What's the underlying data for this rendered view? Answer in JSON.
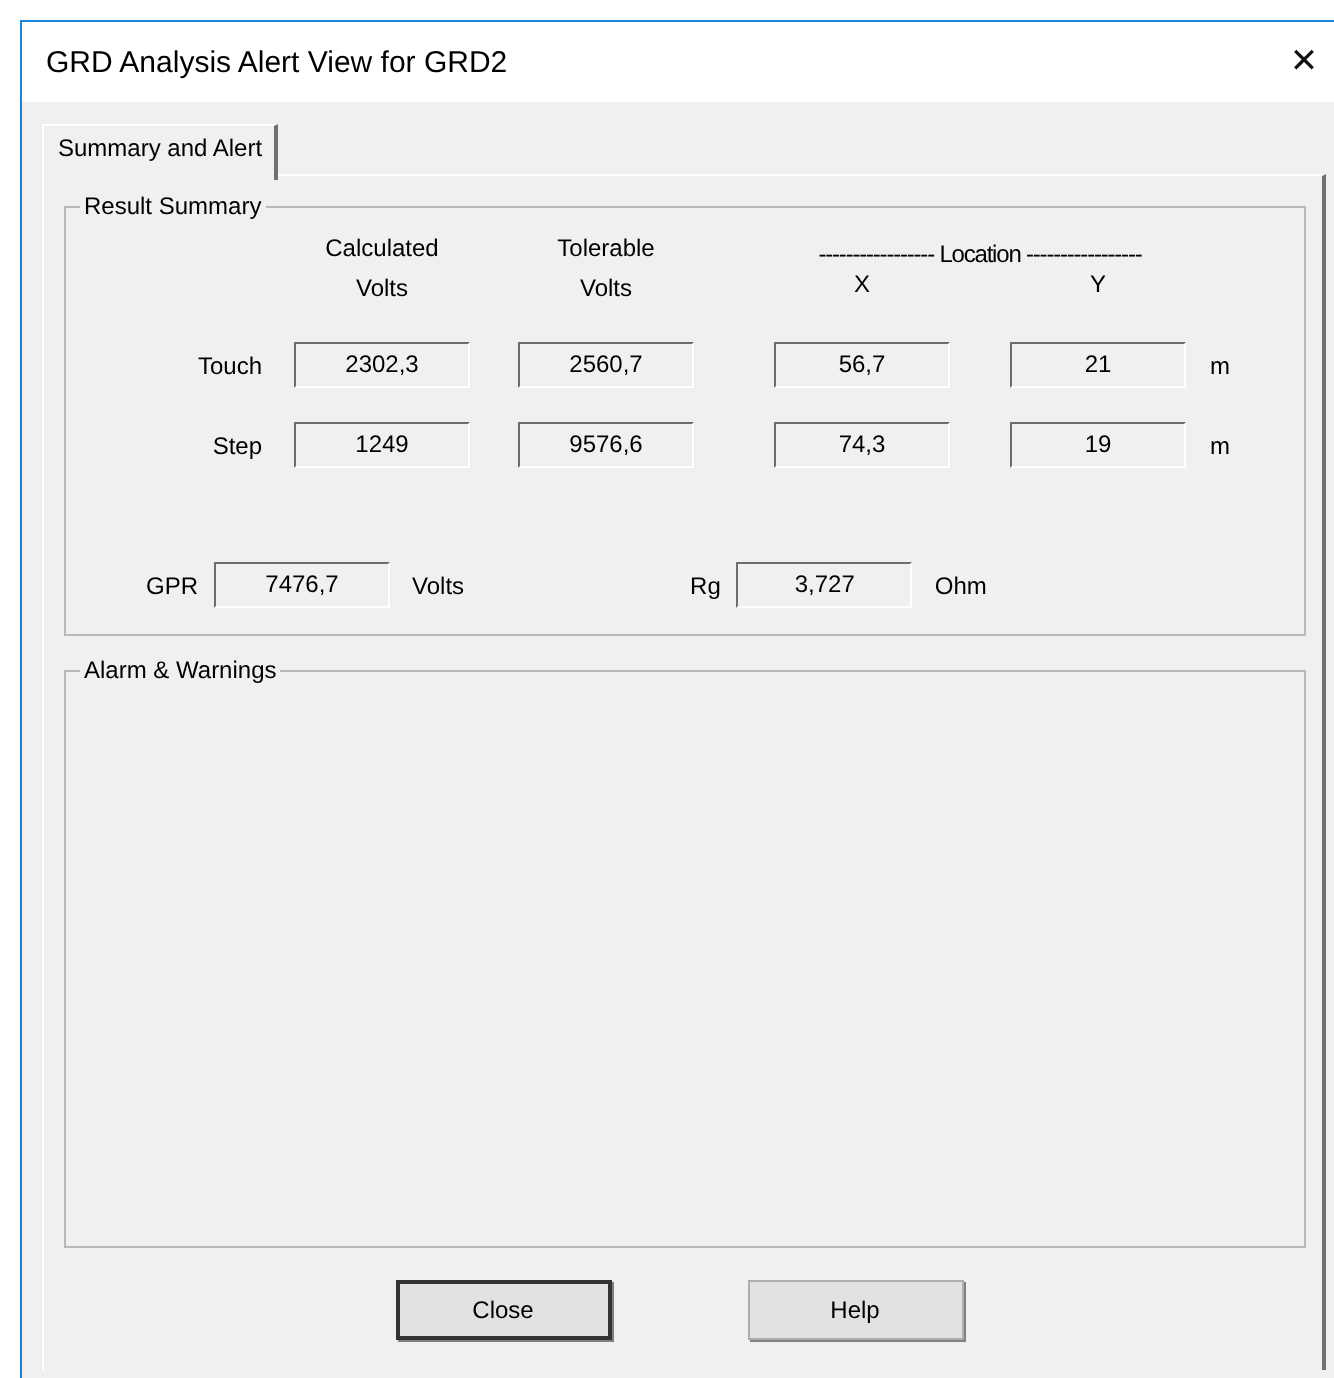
{
  "window": {
    "title": "GRD Analysis Alert View for GRD2",
    "close_glyph": "✕"
  },
  "tabs": [
    {
      "label": "Summary and Alert",
      "selected": true
    }
  ],
  "result_summary": {
    "title": "Result Summary",
    "column_headers": [
      {
        "lines": [
          "Calculated",
          "Volts"
        ]
      },
      {
        "lines": [
          "Tolerable",
          "Volts"
        ]
      }
    ],
    "location_header": "----------------- Location -----------------",
    "location_columns": [
      "X",
      "Y"
    ],
    "rows": [
      {
        "label": "Touch",
        "values": [
          "2302,3",
          "2560,7",
          "56,7",
          "21"
        ],
        "unit": "m"
      },
      {
        "label": "Step",
        "values": [
          "1249",
          "9576,6",
          "74,3",
          "19"
        ],
        "unit": "m"
      }
    ],
    "gpr": {
      "label": "GPR",
      "value": "7476,7",
      "unit": "Volts"
    },
    "rg": {
      "label": "Rg",
      "value": "3,727",
      "unit": "Ohm"
    }
  },
  "alarm_warnings": {
    "title": "Alarm & Warnings"
  },
  "buttons": [
    {
      "label": "Close",
      "default": true
    },
    {
      "label": "Help",
      "default": false
    }
  ]
}
